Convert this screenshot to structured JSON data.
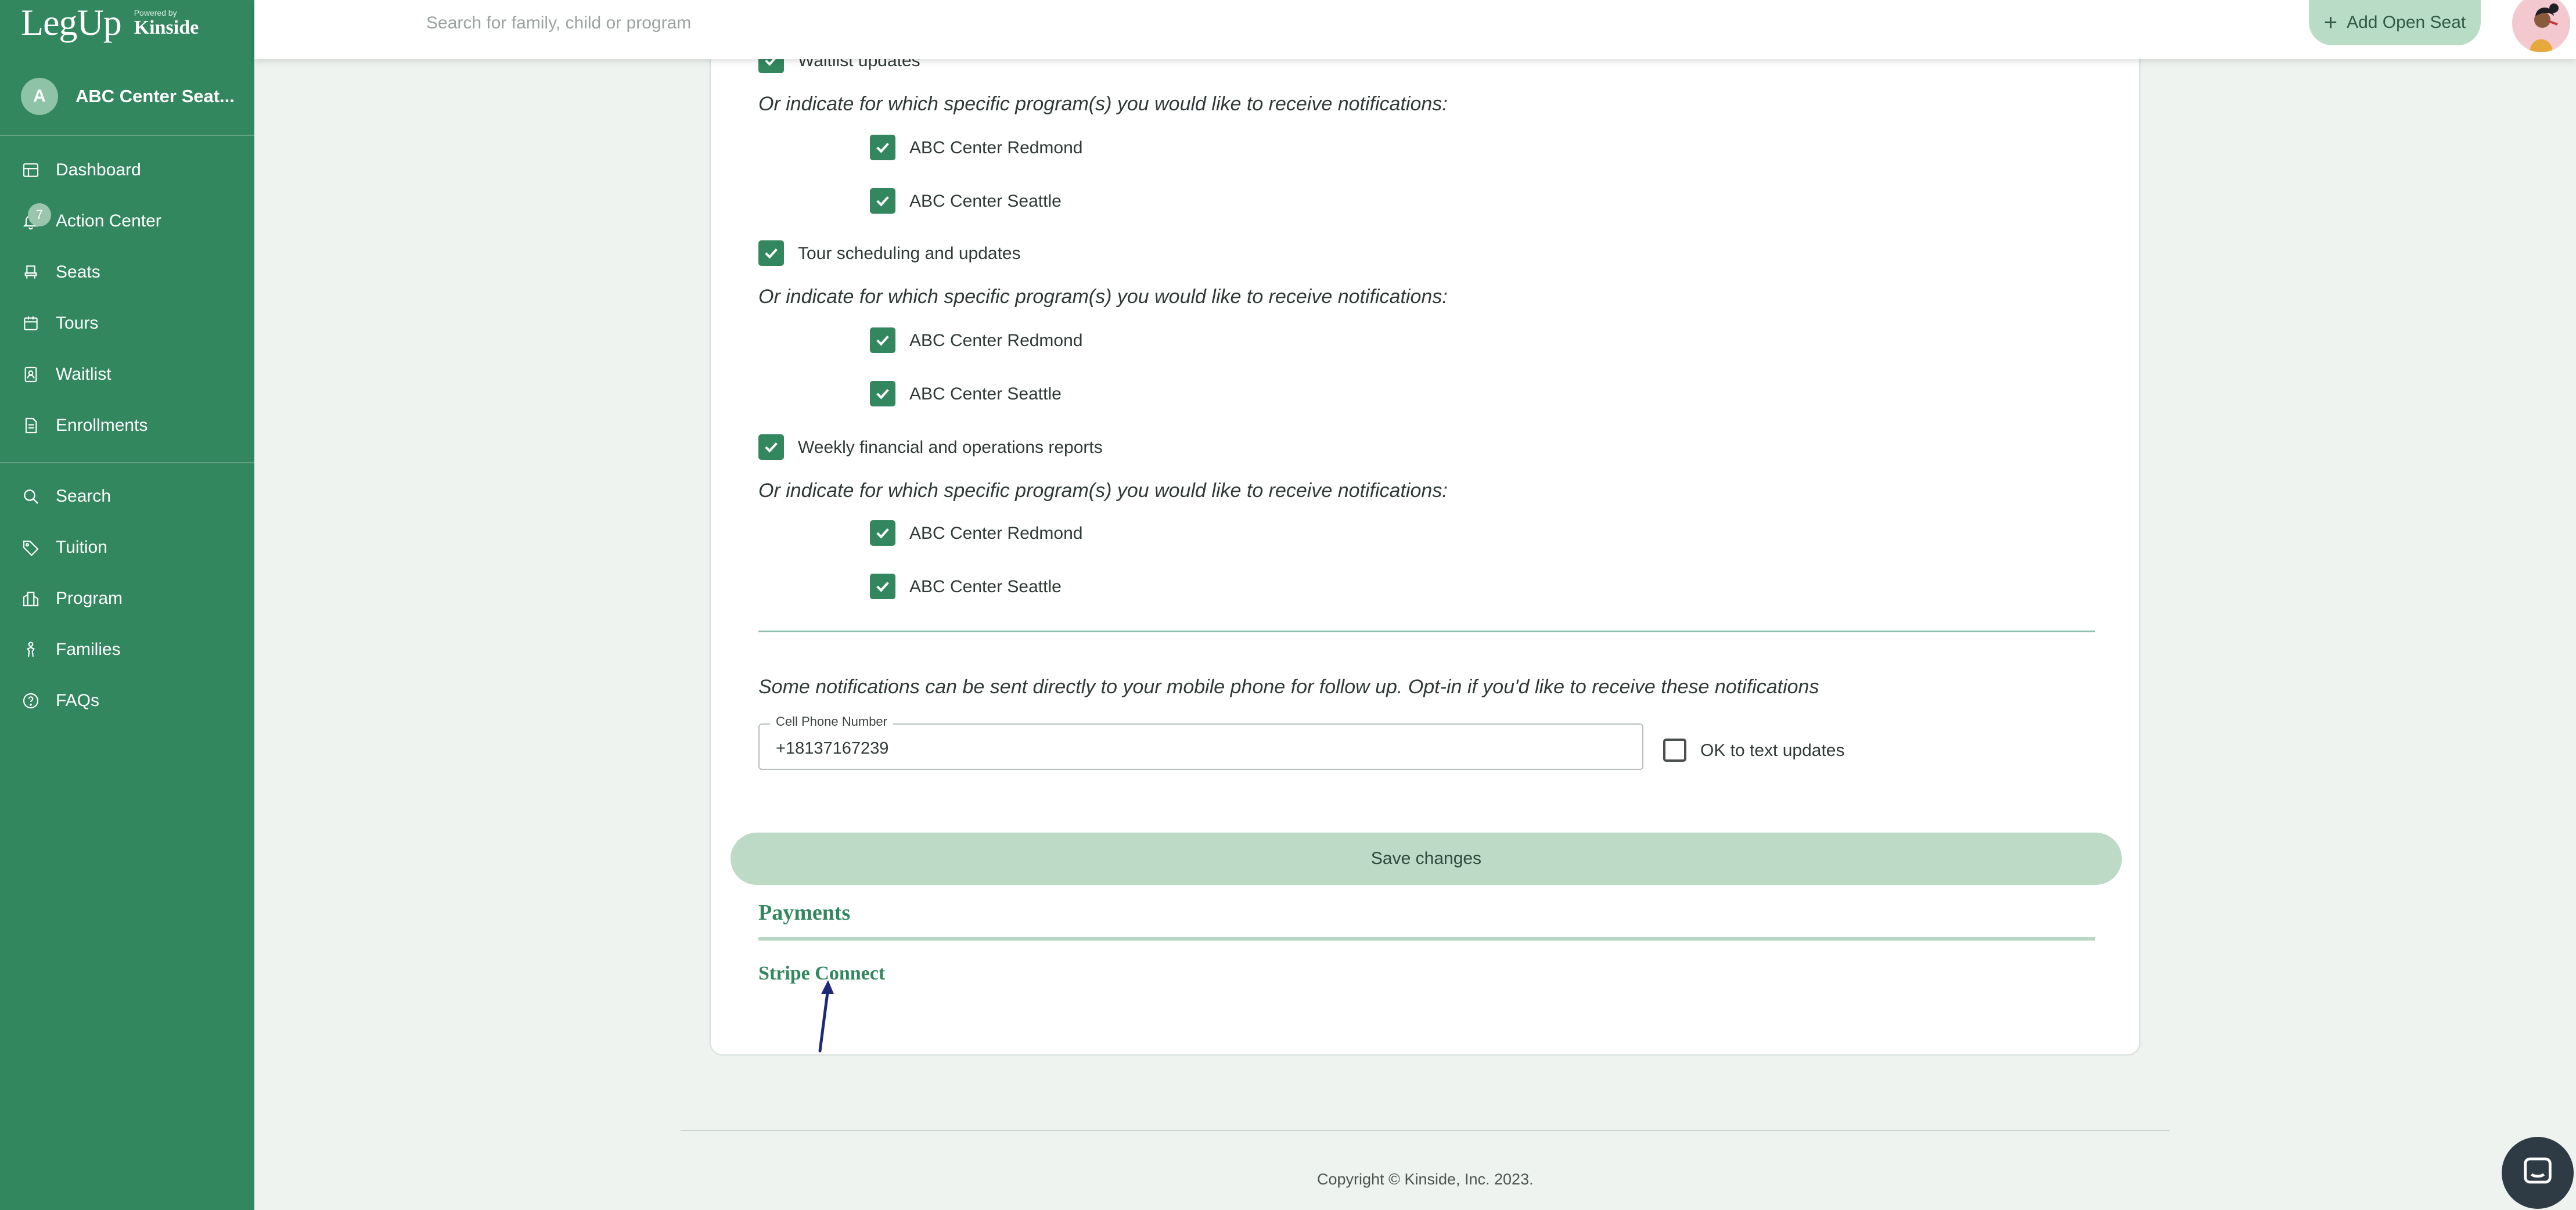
{
  "brand": {
    "logo": "LegUp",
    "powered_by": "Powered by",
    "company": "Kinside"
  },
  "account": {
    "initial": "A",
    "name": "ABC Center Seat..."
  },
  "sidebar": {
    "items": [
      {
        "label": "Dashboard",
        "icon": "dashboard-icon"
      },
      {
        "label": "Action Center",
        "icon": "bell-icon",
        "badge": "7"
      },
      {
        "label": "Seats",
        "icon": "seat-icon"
      },
      {
        "label": "Tours",
        "icon": "calendar-icon"
      },
      {
        "label": "Waitlist",
        "icon": "waitlist-icon"
      },
      {
        "label": "Enrollments",
        "icon": "document-icon"
      },
      {
        "label": "Search",
        "icon": "search-icon"
      },
      {
        "label": "Tuition",
        "icon": "tag-icon"
      },
      {
        "label": "Program",
        "icon": "building-icon"
      },
      {
        "label": "Families",
        "icon": "family-icon"
      },
      {
        "label": "FAQs",
        "icon": "help-icon"
      }
    ]
  },
  "topbar": {
    "search_placeholder": "Search for family, child or program",
    "add_seat_label": "Add Open Seat"
  },
  "notifications": {
    "waitlist_label": "Waitlist updates",
    "specific_prompt": "Or indicate for which specific program(s) you would like to receive notifications:",
    "programs": [
      "ABC Center Redmond",
      "ABC Center Seattle"
    ],
    "tour_label": "Tour scheduling and updates",
    "weekly_label": "Weekly financial and operations reports",
    "mobile_prompt": "Some notifications can be sent directly to your mobile phone for follow up. Opt-in if you'd like to receive these notifications",
    "phone_label": "Cell Phone Number",
    "phone_value": "+18137167239",
    "text_opt_label": "OK to text updates",
    "save_label": "Save changes"
  },
  "payments": {
    "title": "Payments",
    "stripe_label": "Stripe Connect"
  },
  "footer": {
    "copyright": "Copyright © Kinside, Inc. 2023."
  },
  "colors": {
    "sidebar": "#32875f",
    "accent": "#32875f",
    "save_button": "#bddac7",
    "page_bg": "#eef3ef"
  }
}
